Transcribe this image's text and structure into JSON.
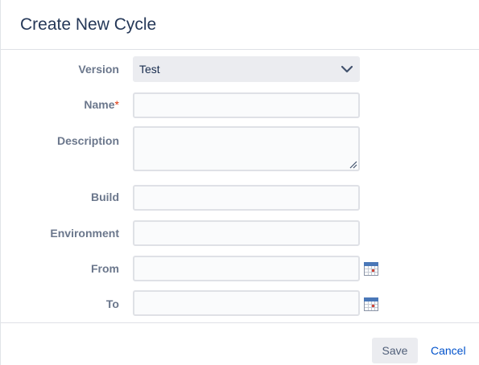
{
  "dialog": {
    "title": "Create New Cycle"
  },
  "form": {
    "version": {
      "label": "Version",
      "value": "Test"
    },
    "name": {
      "label": "Name",
      "required_mark": "*",
      "value": ""
    },
    "description": {
      "label": "Description",
      "value": ""
    },
    "build": {
      "label": "Build",
      "value": ""
    },
    "environment": {
      "label": "Environment",
      "value": ""
    },
    "from": {
      "label": "From",
      "value": ""
    },
    "to": {
      "label": "To",
      "value": ""
    }
  },
  "footer": {
    "save_label": "Save",
    "cancel_label": "Cancel"
  },
  "icons": {
    "dropdown": "chevron-down-icon",
    "date_picker": "calendar-icon"
  },
  "colors": {
    "title": "#253858",
    "label": "#6b778c",
    "required": "#de350b",
    "link": "#0052cc",
    "select_bg": "#ebecf0",
    "field_border": "#dfe1e6"
  }
}
